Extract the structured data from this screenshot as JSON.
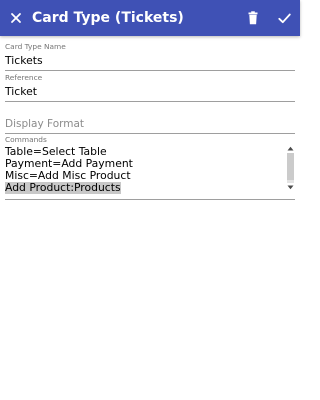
{
  "app_bar": {
    "title": "Card Type (Tickets)",
    "background": "#3f51b5",
    "close_icon": "close-icon",
    "delete_icon": "trash-icon",
    "confirm_icon": "check-icon"
  },
  "form": {
    "card_type_name": {
      "label": "Card Type Name",
      "value": "Tickets"
    },
    "reference": {
      "label": "Reference",
      "value": "Ticket"
    },
    "display_format": {
      "placeholder": "Display Format",
      "value": ""
    },
    "commands": {
      "label": "Commands",
      "lines": [
        "Table=Select Table",
        "Payment=Add Payment",
        "Misc=Add Misc Product",
        "Add Product:Products"
      ],
      "selected_line": "Add Product:Products"
    }
  }
}
